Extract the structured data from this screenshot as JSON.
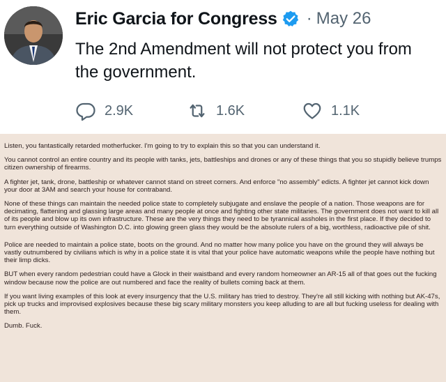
{
  "tweet": {
    "display_name": "Eric Garcia for Congress",
    "separator": "·",
    "date": "May 26",
    "text": "The 2nd Amendment will not protect you from the government.",
    "verified_icon": "verified-badge-icon",
    "avatar_icon": "profile-avatar",
    "actions": {
      "reply": {
        "icon": "reply-icon",
        "count": "2.9K"
      },
      "retweet": {
        "icon": "retweet-icon",
        "count": "1.6K"
      },
      "like": {
        "icon": "heart-icon",
        "count": "1.1K"
      }
    },
    "colors": {
      "verified": "#1d9bf0",
      "muted": "#536471",
      "text": "#0f1419"
    }
  },
  "reply_card": {
    "background": "#f0e4da",
    "paragraphs": [
      "Listen, you fantastically retarded motherfucker. I'm going to try to explain this so that you can understand it.",
      "You cannot control an entire country and its people with tanks, jets, battleships and drones or any of these things that you so stupidly believe trumps citizen ownership of firearms.",
      "A fighter jet, tank, drone, battleship or whatever cannot stand on street corners. And enforce \"no assembly\" edicts. A fighter jet cannot kick down your door at 3AM and search your house for contraband.",
      "None of these things can maintain the needed police state to completely subjugate and enslave the people of a nation. Those weapons are for decimating, flattening and glassing large areas and many people at once and fighting other state militaries. The government does not want to kill all of its people and blow up its own infrastructure. These are the very things they need to be tyrannical assholes in the first place. If they decided to turn everything outside of Washington D.C. into glowing green glass they would be the absolute rulers of a big, worthless, radioactive pile of shit.",
      "Police are needed to maintain a police state, boots on the ground. And no matter how many police you have on the ground they will always be vastly outnumbered by civilians which is why in a police state it is vital that your police have automatic weapons while the people have nothing but their limp dicks.",
      "BUT when every random pedestrian could have a Glock in their waistband and every random homeowner an AR-15 all of that goes out the fucking window because now the police are out numbered and face the reality of bullets coming back at them.",
      "If you want living examples of this look at every insurgency that the U.S. military has tried to destroy. They're all still kicking with nothing but AK-47s, pick up trucks and improvised explosives because these big scary military monsters you keep alluding to are all but fucking useless for dealing with them.",
      "Dumb. Fuck."
    ]
  }
}
